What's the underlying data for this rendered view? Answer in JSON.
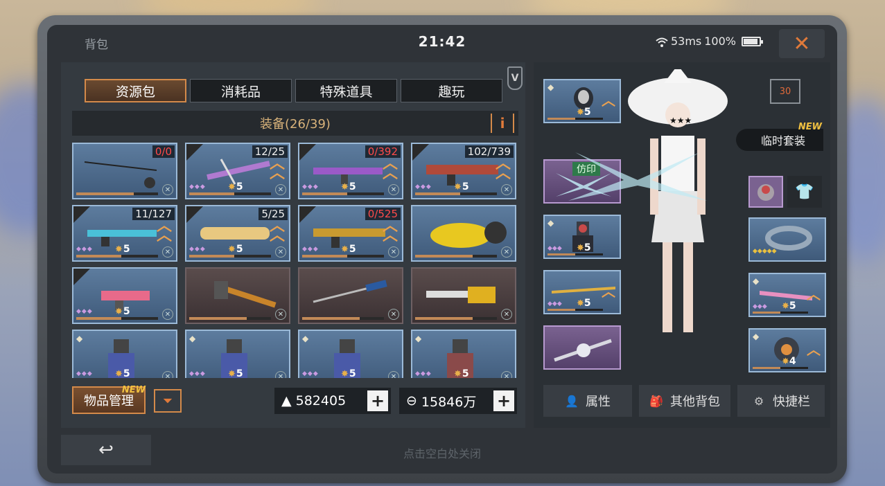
{
  "status": {
    "title": "背包",
    "clock": "21:42",
    "ping": "53ms",
    "battery": "100%"
  },
  "tabs": [
    {
      "label": "资源包",
      "active": true
    },
    {
      "label": "消耗品",
      "active": false
    },
    {
      "label": "特殊道具",
      "active": false
    },
    {
      "label": "趣玩",
      "active": false
    }
  ],
  "v_badge": "V",
  "equip_header": "装备(26/39)",
  "info_label": "i",
  "items": [
    {
      "name": "fishing-rod",
      "count": "0/0",
      "count_red": true,
      "rank": "",
      "bg": "blue"
    },
    {
      "name": "purple-crossbow",
      "count": "12/25",
      "count_red": false,
      "rank": "5",
      "bg": "blue"
    },
    {
      "name": "purple-rifle",
      "count": "0/392",
      "count_red": true,
      "rank": "5",
      "bg": "blue"
    },
    {
      "name": "red-rifle",
      "count": "102/739",
      "count_red": false,
      "rank": "5",
      "bg": "blue"
    },
    {
      "name": "cyan-rifle",
      "count": "11/127",
      "count_red": false,
      "rank": "5",
      "bg": "blue"
    },
    {
      "name": "gold-launcher",
      "count": "5/25",
      "count_red": false,
      "rank": "5",
      "bg": "blue"
    },
    {
      "name": "gold-rifle",
      "count": "0/525",
      "count_red": true,
      "rank": "5",
      "bg": "blue"
    },
    {
      "name": "yellow-vehicle",
      "count": "",
      "count_red": false,
      "rank": "",
      "bg": "blue"
    },
    {
      "name": "pink-pistol",
      "count": "",
      "count_red": false,
      "rank": "5",
      "bg": "blue"
    },
    {
      "name": "hammer",
      "count": "",
      "count_red": false,
      "rank": "",
      "bg": "brown"
    },
    {
      "name": "screwdriver",
      "count": "",
      "count_red": false,
      "rank": "",
      "bg": "brown"
    },
    {
      "name": "chainsaw",
      "count": "",
      "count_red": false,
      "rank": "",
      "bg": "brown"
    },
    {
      "name": "armor-suit-1",
      "count": "",
      "count_red": false,
      "rank": "5",
      "bg": "blue"
    },
    {
      "name": "armor-suit-2",
      "count": "",
      "count_red": false,
      "rank": "5",
      "bg": "blue"
    },
    {
      "name": "armor-suit-3",
      "count": "",
      "count_red": false,
      "rank": "5",
      "bg": "blue"
    },
    {
      "name": "armor-suit-4",
      "count": "",
      "count_red": false,
      "rank": "5",
      "bg": "blue"
    }
  ],
  "bottom": {
    "manage_label": "物品管理",
    "new_tag": "NEW",
    "currency1": "582405",
    "currency2": "15846万"
  },
  "right": {
    "level": "30",
    "temp_outfit": "临时套装",
    "new_tag": "NEW",
    "imprint_tag": "仿印",
    "slot_ranks": {
      "helmet": "5",
      "armor": "5",
      "gold_spear": "5",
      "pink_gun": "5",
      "mech_helmet": "4"
    },
    "actions": [
      "属性",
      "其他背包",
      "快捷栏"
    ]
  },
  "hint": "点击空白处关闭",
  "colors": {
    "accent": "#d48a4a",
    "slot_blue": "#5d7c9e",
    "count_red": "#ff4a4a"
  }
}
